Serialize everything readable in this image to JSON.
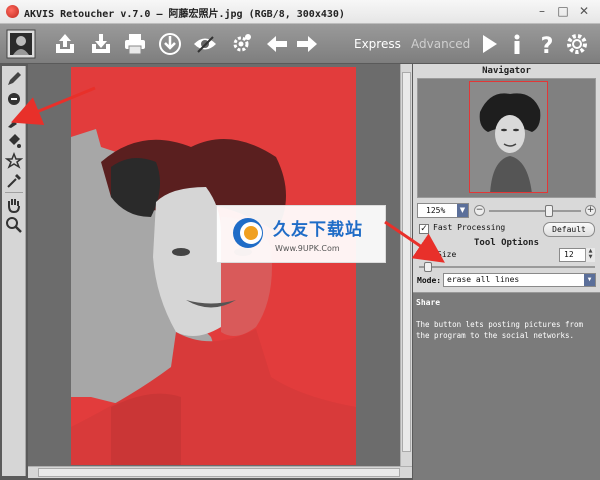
{
  "window": {
    "title": "AKVIS Retoucher v.7.0 — 阿藤宏照片.jpg (RGB/8, 300x430)",
    "minimize": "–",
    "restore": "□",
    "close": "✕"
  },
  "toolbar": {
    "icons": [
      "open-icon",
      "save-icon",
      "print-icon",
      "share-icon",
      "preset-icon",
      "settings-gear-icon",
      "back-arrow-icon",
      "forward-arrow-icon",
      "run-icon",
      "info-icon",
      "help-icon",
      "preferences-icon"
    ],
    "mode_express": "Express",
    "mode_advanced": "Advanced",
    "active_mode": "Express"
  },
  "tools": [
    "pencil-tool-icon",
    "eraser-tool-icon",
    "brush-tool-icon",
    "fill-tool-icon",
    "magic-tool-icon",
    "eyedropper-tool-icon",
    "hand-tool-icon",
    "zoom-tool-icon"
  ],
  "navigator": {
    "title": "Navigator",
    "zoom_value": "125%",
    "zoom_minus": "−",
    "zoom_plus": "+",
    "zoom_level_fraction": 0.65
  },
  "options": {
    "fast_processing_label": "Fast Processing",
    "fast_processing_checked": "✓",
    "default_button": "Default",
    "tool_options_title": "Tool Options",
    "size_label": "Size",
    "size_value": "12",
    "size_fraction": 0.05,
    "mode_label": "Mode:",
    "mode_value": "erase all lines"
  },
  "help": {
    "title": "Share",
    "description": "The button lets posting pictures from the program to the social networks."
  },
  "watermark": {
    "chinese": "久友下载站",
    "url": "Www.9UPK.Com"
  },
  "colors": {
    "accent_red": "#e23737",
    "annotation_red": "#e8302a",
    "watermark_blue": "#1f6cc7"
  }
}
